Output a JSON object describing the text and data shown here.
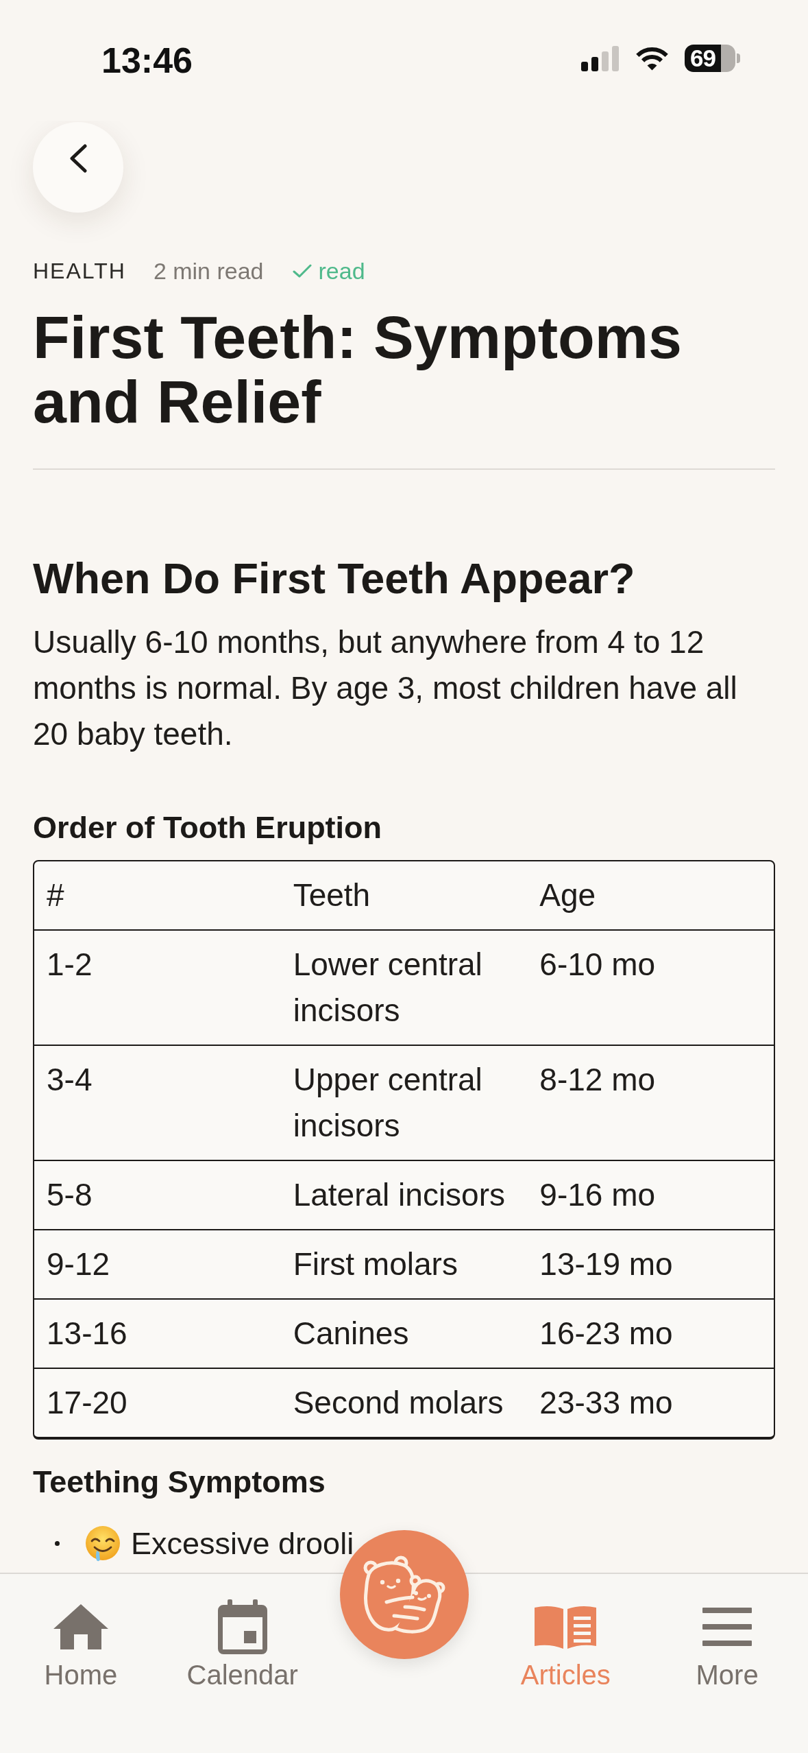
{
  "status_bar": {
    "time": "13:46",
    "battery": "69"
  },
  "article": {
    "category": "HEALTH",
    "read_time": "2 min read",
    "read": true,
    "read_label": "read",
    "title": "First Teeth: Symptoms and Relief"
  },
  "sections": [
    {
      "kind": "heading",
      "text": "When Do First Teeth Appear?"
    },
    {
      "kind": "paragraph",
      "text": "Usually 6-10 months, but anywhere from 4 to 12 months is normal. By age 3, most children have all 20 baby teeth."
    },
    {
      "kind": "subheading",
      "text": "Order of Tooth Eruption"
    },
    {
      "kind": "table",
      "columns": [
        "#",
        "Teeth",
        "Age"
      ],
      "rows": [
        [
          "1-2",
          "Lower central incisors",
          "6-10 mo"
        ],
        [
          "3-4",
          "Upper central incisors",
          "8-12 mo"
        ],
        [
          "5-8",
          "Lateral incisors",
          "9-16 mo"
        ],
        [
          "9-12",
          "First molars",
          "13-19 mo"
        ],
        [
          "13-16",
          "Canines",
          "16-23 mo"
        ],
        [
          "17-20",
          "Second molars",
          "23-33 mo"
        ]
      ]
    },
    {
      "kind": "subheading",
      "text": "Teething Symptoms"
    },
    {
      "kind": "bullet_list",
      "items": [
        "Excessive drooli"
      ]
    }
  ],
  "tab_bar": {
    "tabs": [
      {
        "label": "Home",
        "selected": false
      },
      {
        "label": "Calendar",
        "selected": false
      },
      {
        "label": "Articles",
        "selected": true
      },
      {
        "label": "More",
        "selected": false
      }
    ]
  }
}
